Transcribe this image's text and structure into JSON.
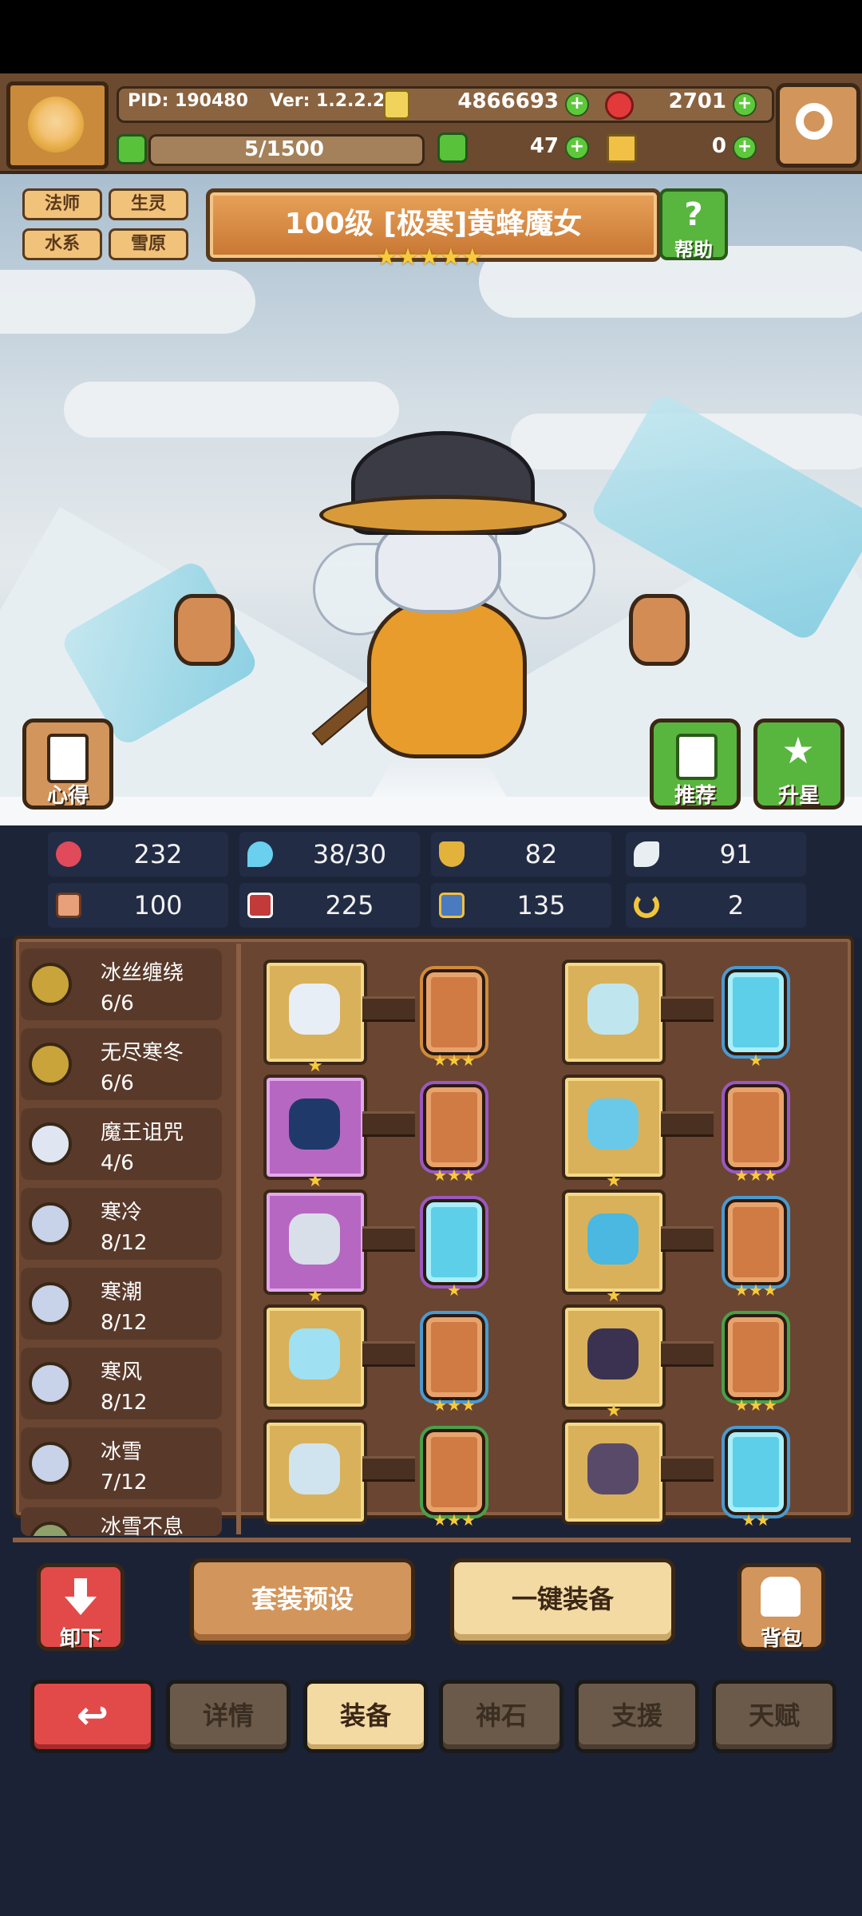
{
  "header": {
    "pid": "PID: 190480",
    "version": "Ver: 1.2.2.2",
    "gold": "4866693",
    "ruby": "2701",
    "stamina": "5/1500",
    "clover": "47",
    "cheese": "0"
  },
  "tags": [
    "法师",
    "生灵",
    "水系",
    "雪原"
  ],
  "hero": {
    "title": "100级  [极寒]黄蜂魔女",
    "stars": "★★★★★",
    "help_label": "帮助",
    "notes_label": "心得",
    "recommend_label": "推荐",
    "upgrade_label": "升星"
  },
  "stats": [
    "232",
    "38/30",
    "82",
    "91",
    "100",
    "225",
    "135",
    "2"
  ],
  "sets": [
    {
      "name": "冰丝缠绕",
      "progress": "6/6"
    },
    {
      "name": "无尽寒冬",
      "progress": "6/6"
    },
    {
      "name": "魔王诅咒",
      "progress": "4/6"
    },
    {
      "name": "寒冷",
      "progress": "8/12"
    },
    {
      "name": "寒潮",
      "progress": "8/12"
    },
    {
      "name": "寒风",
      "progress": "8/12"
    },
    {
      "name": "冰雪",
      "progress": "7/12"
    },
    {
      "name": "冰雪不息",
      "progress": ""
    }
  ],
  "equipment": [
    {
      "item_icon": "wand-icon",
      "item_stars": "★",
      "gem_icon": "orange-rune-icon",
      "gem_stars": "★★★"
    },
    {
      "item_icon": "ice-crown-icon",
      "item_stars": "",
      "gem_icon": "blue-crystal-icon",
      "gem_stars": "★"
    },
    {
      "item_icon": "dark-orb-icon",
      "item_stars": "★",
      "gem_icon": "orange-rune-icon",
      "gem_stars": "★★★"
    },
    {
      "item_icon": "ice-cape-icon",
      "item_stars": "★",
      "gem_icon": "orange-rune-icon",
      "gem_stars": "★★★"
    },
    {
      "item_icon": "heart-necklace-icon",
      "item_stars": "★",
      "gem_icon": "blue-crystal-icon",
      "gem_stars": "★"
    },
    {
      "item_icon": "ice-glove-icon",
      "item_stars": "★",
      "gem_icon": "orange-rune-icon",
      "gem_stars": "★★★"
    },
    {
      "item_icon": "snowflake-icon",
      "item_stars": "",
      "gem_icon": "orange-rune-icon",
      "gem_stars": "★★★"
    },
    {
      "item_icon": "demon-armor-icon",
      "item_stars": "★",
      "gem_icon": "orange-rune-icon",
      "gem_stars": "★★★"
    },
    {
      "item_icon": "ice-ring-icon",
      "item_stars": "",
      "gem_icon": "orange-rune-icon",
      "gem_stars": "★★★"
    },
    {
      "item_icon": "boots-icon",
      "item_stars": "",
      "gem_icon": "blue-crystal-icon",
      "gem_stars": "★★"
    }
  ],
  "actions": {
    "unequip": "卸下",
    "preset": "套装预设",
    "auto_equip": "一键装备",
    "bag": "背包"
  },
  "tabs": [
    "详情",
    "装备",
    "神石",
    "支援",
    "天赋"
  ],
  "active_tab": "装备"
}
